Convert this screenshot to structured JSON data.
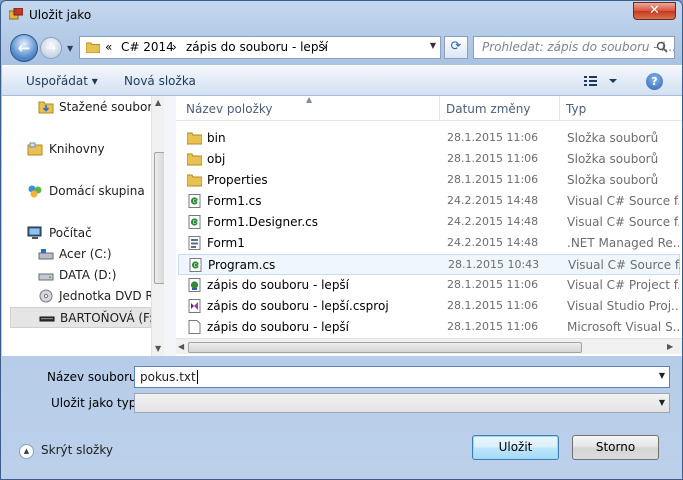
{
  "window": {
    "title": "Uložit jako",
    "close_label": "✕"
  },
  "address": {
    "crumbs": [
      "«",
      "C# 2014",
      "›",
      "zápis do souboru - lepší",
      "›"
    ],
    "search_placeholder": "Prohledat: zápis do souboru - l..."
  },
  "toolbar": {
    "organize": "Uspořádat ▾",
    "new_folder": "Nová složka",
    "help": "?"
  },
  "nav": [
    {
      "label": "Stažené soubory",
      "icon": "downloads-folder-icon"
    },
    {
      "label": "Knihovny",
      "icon": "libraries-icon"
    },
    {
      "label": "Domácí skupina",
      "icon": "homegroup-icon"
    },
    {
      "label": "Počítač",
      "icon": "computer-icon"
    },
    {
      "label": "Acer (C:)",
      "icon": "drive-icon"
    },
    {
      "label": "DATA (D:)",
      "icon": "drive-icon"
    },
    {
      "label": "Jednotka DVD RW",
      "icon": "dvd-drive-icon"
    },
    {
      "label": "BARTOŇOVÁ (F:)",
      "icon": "usb-drive-icon"
    }
  ],
  "columns": {
    "name": "Název položky",
    "date": "Datum změny",
    "type": "Typ"
  },
  "files": [
    {
      "name": "bin",
      "date": "28.1.2015 11:06",
      "type": "Složka souborů",
      "icon": "folder-icon"
    },
    {
      "name": "obj",
      "date": "28.1.2015 11:06",
      "type": "Složka souborů",
      "icon": "folder-icon"
    },
    {
      "name": "Properties",
      "date": "28.1.2015 11:06",
      "type": "Složka souborů",
      "icon": "folder-icon"
    },
    {
      "name": "Form1.cs",
      "date": "24.2.2015 14:48",
      "type": "Visual C# Source f...",
      "icon": "csharp-file-icon"
    },
    {
      "name": "Form1.Designer.cs",
      "date": "24.2.2015 14:48",
      "type": "Visual C# Source f...",
      "icon": "csharp-file-icon"
    },
    {
      "name": "Form1",
      "date": "24.2.2015 14:48",
      "type": ".NET Managed Re...",
      "icon": "resource-file-icon"
    },
    {
      "name": "Program.cs",
      "date": "28.1.2015 10:43",
      "type": "Visual C# Source f...",
      "icon": "csharp-file-icon"
    },
    {
      "name": "zápis do souboru - lepší",
      "date": "28.1.2015 11:06",
      "type": "Visual C# Project f...",
      "icon": "csproj-file-icon"
    },
    {
      "name": "zápis do souboru - lepší.csproj",
      "date": "28.1.2015 11:06",
      "type": "Visual Studio Proj...",
      "icon": "vs-project-icon"
    },
    {
      "name": "zápis do souboru - lepší",
      "date": "28.1.2015 11:06",
      "type": "Microsoft Visual S...",
      "icon": "blank-file-icon"
    }
  ],
  "form": {
    "filename_label": "Název souboru:",
    "filename_value": "pokus.txt",
    "filetype_label": "Uložit jako typ:",
    "filetype_value": ""
  },
  "footer": {
    "hide_folders": "Skrýt složky",
    "save": "Uložit",
    "cancel": "Storno"
  },
  "colors": {
    "accent": "#3c7fb1",
    "folder": "#e8c150",
    "selection": "#f0f6fd"
  }
}
